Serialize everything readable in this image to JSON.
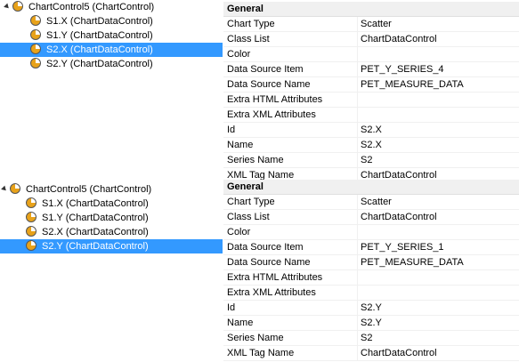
{
  "panels": [
    {
      "tree": {
        "root": "ChartControl5 (ChartControl)",
        "items": [
          "S1.X (ChartDataControl)",
          "S1.Y (ChartDataControl)",
          "S2.X (ChartDataControl)",
          "S2.Y (ChartDataControl)"
        ],
        "selected_index": 2
      },
      "properties": {
        "category": "General",
        "rows": [
          {
            "name": "Chart Type",
            "value": "Scatter"
          },
          {
            "name": "Class List",
            "value": "ChartDataControl"
          },
          {
            "name": "Color",
            "value": ""
          },
          {
            "name": "Data Source Item",
            "value": "PET_Y_SERIES_4"
          },
          {
            "name": "Data Source Name",
            "value": "PET_MEASURE_DATA"
          },
          {
            "name": "Extra HTML Attributes",
            "value": ""
          },
          {
            "name": "Extra XML Attributes",
            "value": ""
          },
          {
            "name": "Id",
            "value": "S2.X"
          },
          {
            "name": "Name",
            "value": "S2.X"
          },
          {
            "name": "Series Name",
            "value": "S2"
          },
          {
            "name": "XML Tag Name",
            "value": "ChartDataControl"
          }
        ]
      }
    },
    {
      "tree": {
        "root": "ChartControl5 (ChartControl)",
        "items": [
          "S1.X (ChartDataControl)",
          "S1.Y (ChartDataControl)",
          "S2.X (ChartDataControl)",
          "S2.Y (ChartDataControl)"
        ],
        "selected_index": 3
      },
      "properties": {
        "category": "General",
        "rows": [
          {
            "name": "Chart Type",
            "value": "Scatter"
          },
          {
            "name": "Class List",
            "value": "ChartDataControl"
          },
          {
            "name": "Color",
            "value": ""
          },
          {
            "name": "Data Source Item",
            "value": "PET_Y_SERIES_1"
          },
          {
            "name": "Data Source Name",
            "value": "PET_MEASURE_DATA"
          },
          {
            "name": "Extra HTML Attributes",
            "value": ""
          },
          {
            "name": "Extra XML Attributes",
            "value": ""
          },
          {
            "name": "Id",
            "value": "S2.Y"
          },
          {
            "name": "Name",
            "value": "S2.Y"
          },
          {
            "name": "Series Name",
            "value": "S2"
          },
          {
            "name": "XML Tag Name",
            "value": "ChartDataControl"
          }
        ]
      }
    }
  ],
  "icons": {
    "expander": "collapse-triangle-icon",
    "node": "chart-data-icon"
  },
  "colors": {
    "selection": "#3399ff",
    "category_bg": "#f0f0f0",
    "icon": "#e8a21a"
  }
}
